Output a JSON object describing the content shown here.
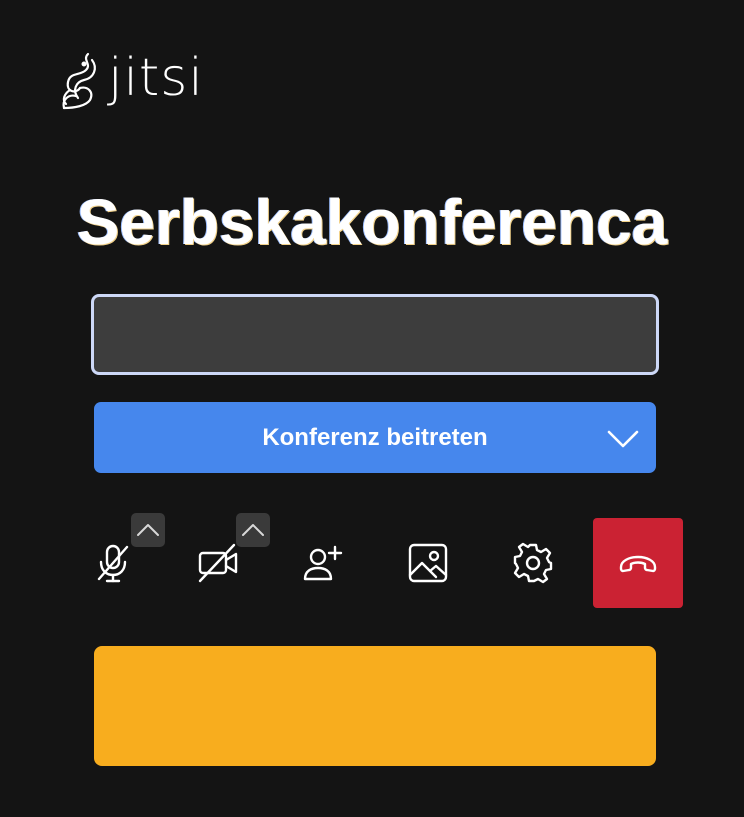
{
  "app": {
    "logo_text": "jitsi"
  },
  "room": {
    "title": "Serbskakonferenca"
  },
  "name_input": {
    "value": "",
    "placeholder": ""
  },
  "join": {
    "label": "Konferenz beitreten"
  },
  "toolbar": {
    "buttons": [
      {
        "icon": "microphone-off-icon"
      },
      {
        "icon": "camera-off-icon"
      },
      {
        "icon": "invite-person-icon"
      },
      {
        "icon": "background-image-icon"
      },
      {
        "icon": "settings-gear-icon"
      },
      {
        "icon": "hangup-phone-icon"
      }
    ]
  },
  "colors": {
    "background": "#141414",
    "join_button": "#4687ed",
    "hangup": "#cb2233",
    "notice": "#f8ad1e",
    "input_bg": "#3d3d3d",
    "input_border": "#cdd8f7"
  }
}
